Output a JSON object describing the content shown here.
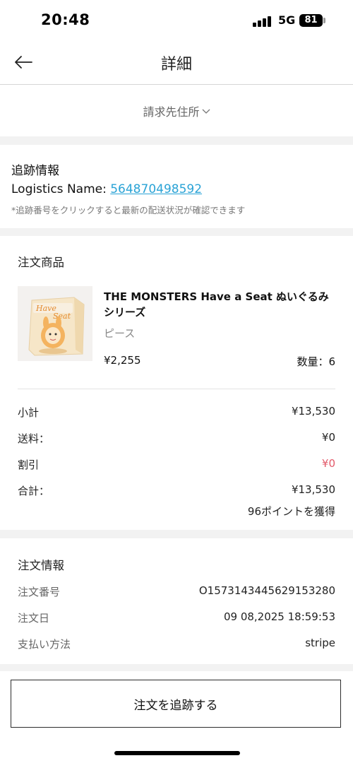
{
  "status_bar": {
    "time": "20:48",
    "network": "5G",
    "battery": "81"
  },
  "header": {
    "title": "詳細",
    "back_icon": "arrow-left-icon"
  },
  "address": {
    "label": "請求先住所",
    "icon": "chevron-down-icon"
  },
  "tracking": {
    "title": "追跡情報",
    "logistics_label": "Logistics Name: ",
    "tracking_number": "564870498592",
    "note": "*追跡番号をクリックすると最新の配送状況が確認できます"
  },
  "products": {
    "section_title": "注文商品",
    "items": [
      {
        "name": "THE MONSTERS Have a Seat ぬいぐるみシリーズ",
        "variant": "ピース",
        "price": "¥2,255",
        "quantity": "数量：6"
      }
    ]
  },
  "summary": {
    "subtotal_label": "小計",
    "subtotal_value": "¥13,530",
    "shipping_label": "送料：",
    "shipping_value": "¥0",
    "discount_label": "割引",
    "discount_value": "¥0",
    "total_label": "合計：",
    "total_value": "¥13,530",
    "points": "96ポイントを獲得"
  },
  "order_info": {
    "title": "注文情報",
    "number_label": "注文番号",
    "number_value": "O1573143445629153280",
    "date_label": "注文日",
    "date_value": "09 08,2025 18:59:53",
    "payment_label": "支払い方法",
    "payment_value": "stripe"
  },
  "actions": {
    "track_button": "注文を追跡する"
  },
  "colors": {
    "link": "#2aa3d6",
    "discount": "#e35a6a",
    "separator": "#f2f2f2"
  }
}
